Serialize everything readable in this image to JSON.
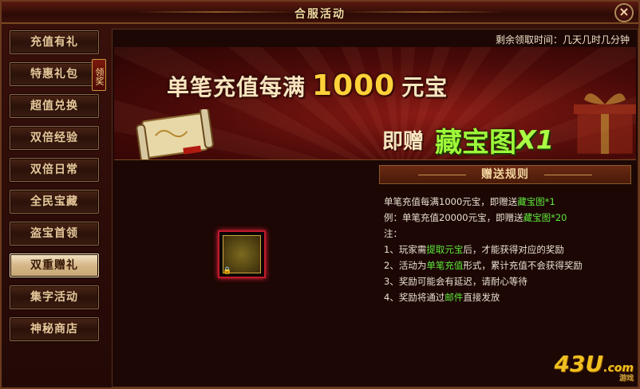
{
  "window": {
    "title": "合服活动",
    "close_label": "×"
  },
  "sidebar": {
    "badge": "领奖",
    "items": [
      {
        "label": "充值有礼"
      },
      {
        "label": "特惠礼包"
      },
      {
        "label": "超值兑换"
      },
      {
        "label": "双倍经验"
      },
      {
        "label": "双倍日常"
      },
      {
        "label": "全民宝藏"
      },
      {
        "label": "盗宝首领"
      },
      {
        "label": "双重赠礼"
      },
      {
        "label": "集字活动"
      },
      {
        "label": "神秘商店"
      }
    ],
    "active_index": 7
  },
  "timer": "剩余领取时间：几天几时几分钟",
  "banner": {
    "headline_pre": "单笔充值每满",
    "headline_num": "1000",
    "headline_post": "元宝",
    "reward_pre": "即赠",
    "reward_item": "藏宝图",
    "reward_qty": "X1"
  },
  "rules": {
    "title": "赠送规则",
    "line1_a": "单笔充值每满1000元宝，即赠送",
    "line1_b": "藏宝图*1",
    "line2_a": "例：单笔充值20000元宝，即赠送",
    "line2_b": "藏宝图*20",
    "note_label": "注：",
    "n1_a": "1、玩家需",
    "n1_b": "提取元宝",
    "n1_c": "后，才能获得对应的奖励",
    "n2_a": "2、活动为",
    "n2_b": "单笔充值",
    "n2_c": "形式，累计充值不会获得奖励",
    "n3": "3、奖励可能会有延迟，请耐心等待",
    "n4_a": "4、奖励将通过",
    "n4_b": "邮件",
    "n4_c": "直接发放"
  },
  "item_slot": {
    "icon": "treasure-map-icon"
  },
  "watermark": {
    "main": "43U",
    "sub": ".com",
    "small": "游戏"
  },
  "colors": {
    "highlight_green": "#5ee83a",
    "gold": "#ffd23a",
    "frame": "#8a6a44"
  }
}
